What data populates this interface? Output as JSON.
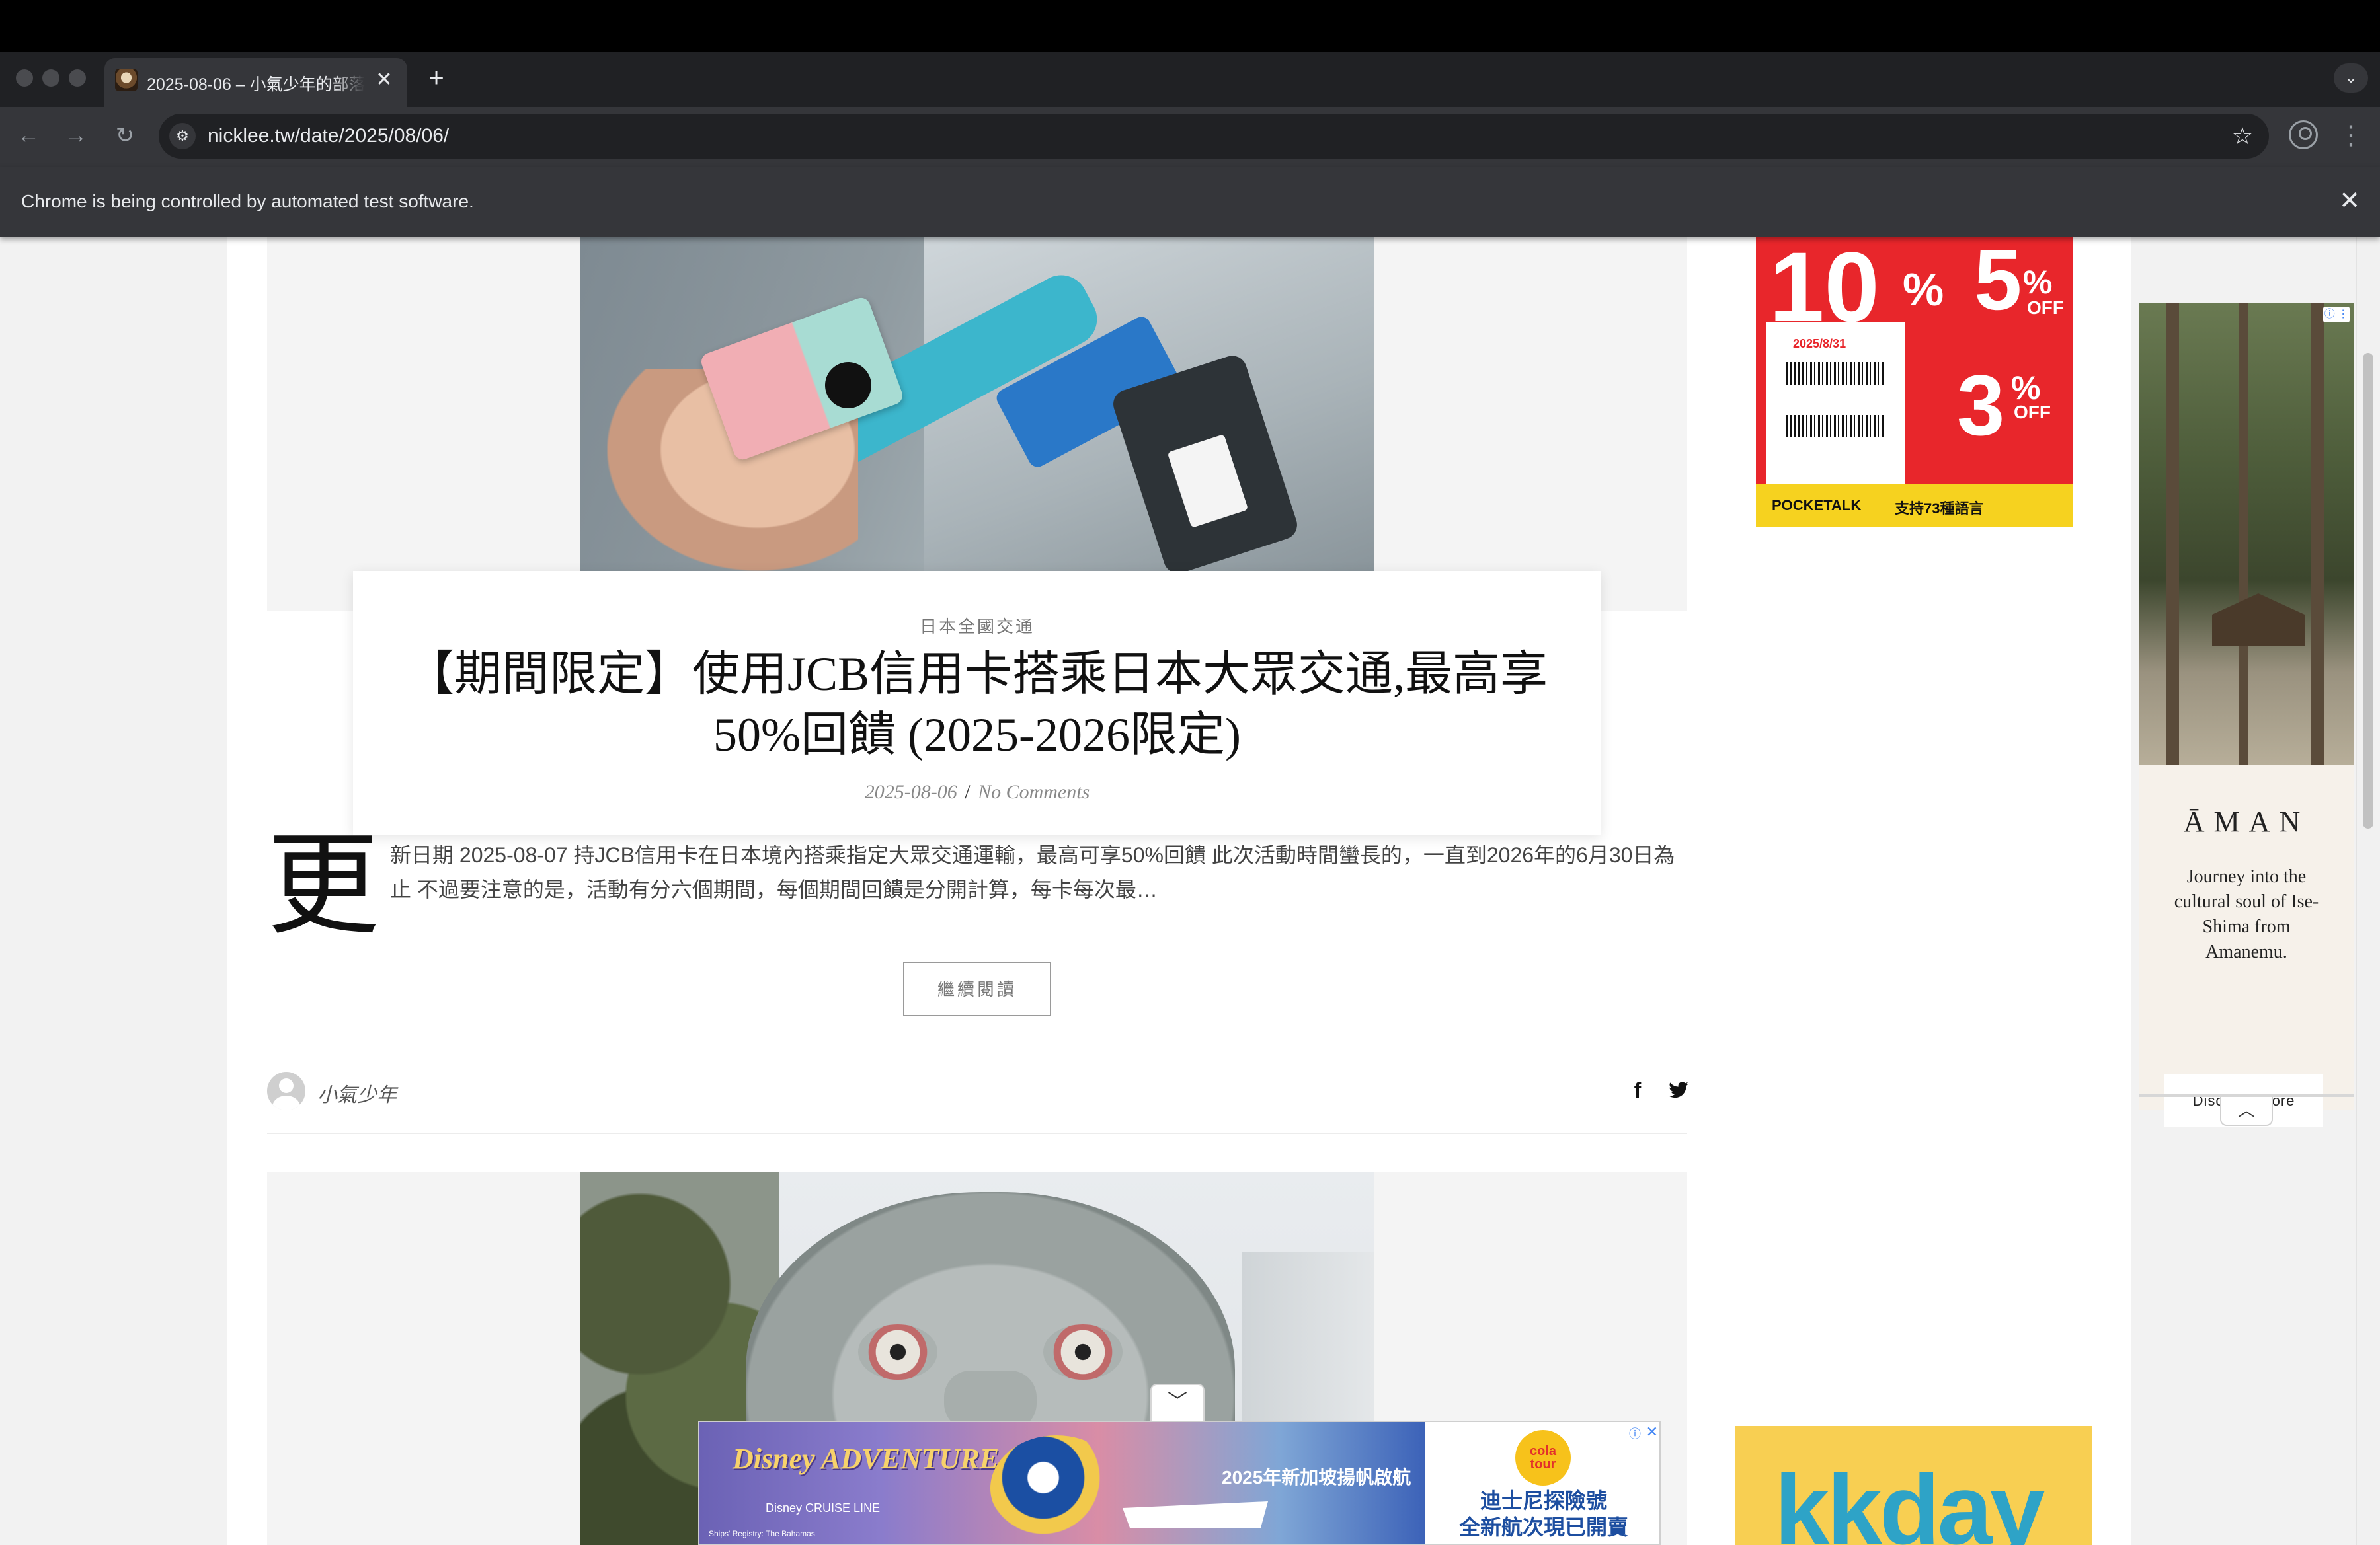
{
  "browser": {
    "tab_title": "2025-08-06 – 小氣少年的部落",
    "url": "nicklee.tw/date/2025/08/06/",
    "infobar_message": "Chrome is being controlled by automated test software.",
    "icons": [
      "close-icon",
      "plus-icon",
      "chevron-down-icon",
      "back-arrow-icon",
      "forward-arrow-icon",
      "reload-icon",
      "site-settings-icon",
      "star-icon",
      "profile-icon",
      "more-vert-icon"
    ]
  },
  "post": {
    "category": "日本全國交通",
    "title": "【期間限定】使用JCB信用卡搭乘日本大眾交通,最高享50%回饋 (2025-2026限定)",
    "date": "2025-08-06",
    "meta_sep": "/",
    "comments": "No Comments",
    "dropcap": "更",
    "excerpt": "新日期 2025-08-07 持JCB信用卡在日本境內搭乘指定大眾交通運輸，最高可享50%回饋 此次活動時間蠻長的，一直到2026年的6月30日為止 不過要注意的是，活動有分六個期間，每個期間回饋是分開計算，每卡每次最…",
    "read_more": "繼續閱讀",
    "author": "小氣少年",
    "share_icons": [
      "facebook-icon",
      "twitter-icon"
    ]
  },
  "ads": {
    "coupon": {
      "discount_1": "10",
      "discount_2": "5",
      "discount_3": "3",
      "unit": "%",
      "off": "OFF",
      "date": "2025/8/31",
      "footer": "POCKETALK",
      "footer_note": "支持73種語言"
    },
    "aman": {
      "info_icon": "ⓘ ⋮",
      "logo": "ĀMAN",
      "copy": "Journey into the cultural soul of Ise-Shima from Amanemu.",
      "cta": "Discover More"
    },
    "kkday": {
      "logo": "kkday"
    },
    "bottom": {
      "brand": "Disney ADVENTURE",
      "line": "Disney CRUISE LINE",
      "promo": "2025年新加坡揚帆啟航",
      "fine_print": "Ships' Registry: The Bahamas",
      "badge": "cola tour",
      "line1": "迪士尼探險號",
      "line2": "全新航次現已開賣"
    }
  },
  "colors": {
    "chrome_dark": "#202124",
    "chrome_mid": "#35363a",
    "coupon_red": "#e8262b",
    "kkday_yellow": "#f8cf52",
    "kkday_blue": "#2ea3c7"
  }
}
